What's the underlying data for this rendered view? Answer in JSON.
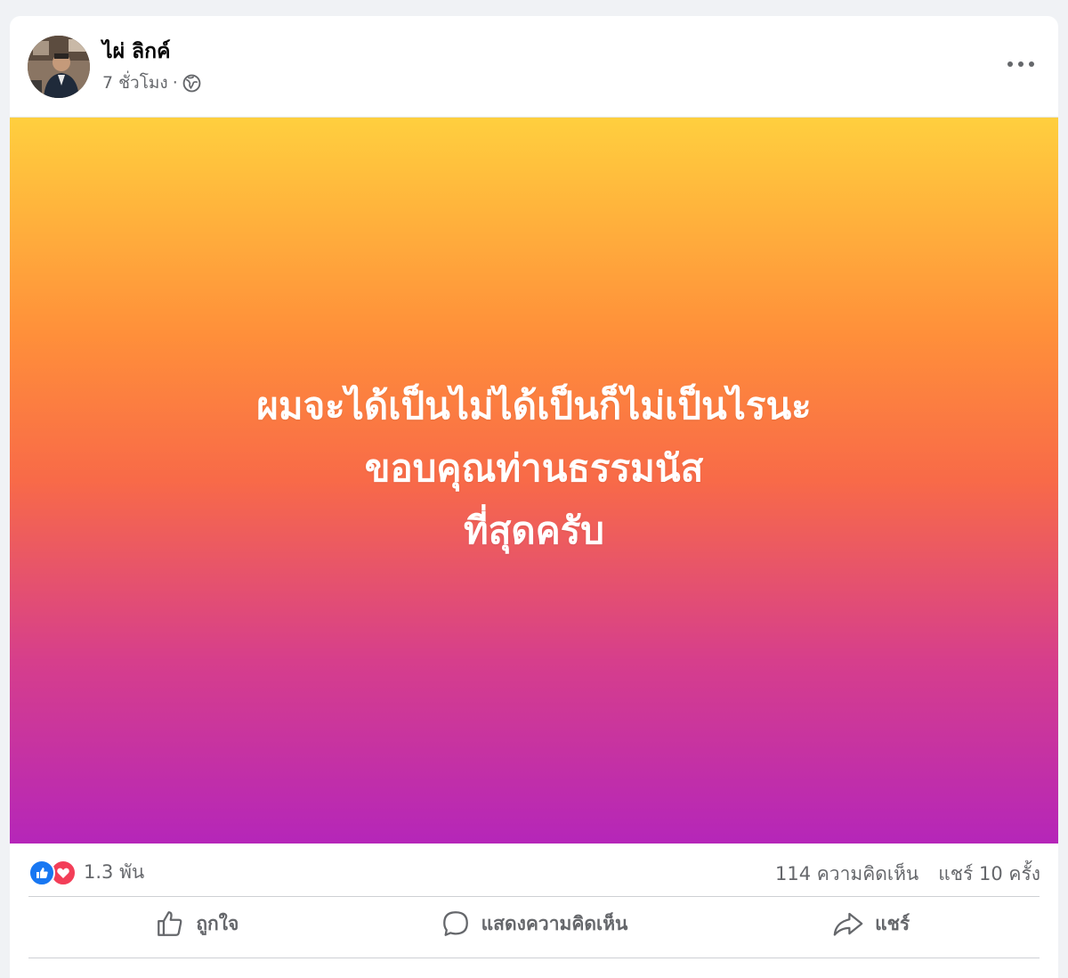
{
  "post": {
    "author_name": "ไผ่ ลิกค์",
    "time": "7 ชั่วโมง",
    "separator": "·",
    "privacy_icon": "globe-icon",
    "more_icon": "more-horizontal-icon",
    "background_colors": [
      "#ffcf3e",
      "#ff8f3a",
      "#f86a48",
      "#d63e8c",
      "#b526b9"
    ],
    "text_lines": [
      "ผมจะได้เป็นไม่ได้เป็นก็ไม่เป็นไรนะ",
      "ขอบคุณท่านธรรมนัส",
      "ที่สุดครับ"
    ]
  },
  "stats": {
    "reaction_count": "1.3 พัน",
    "reaction_icons": [
      "like-reaction-icon",
      "love-reaction-icon"
    ],
    "comments": "114 ความคิดเห็น",
    "shares": "แชร์ 10 ครั้ง"
  },
  "actions": {
    "like_label": "ถูกใจ",
    "comment_label": "แสดงความคิดเห็น",
    "share_label": "แชร์"
  },
  "colors": {
    "like_blue": "#1877f2",
    "love_red": "#f33e58",
    "secondary_text": "#65676b"
  }
}
